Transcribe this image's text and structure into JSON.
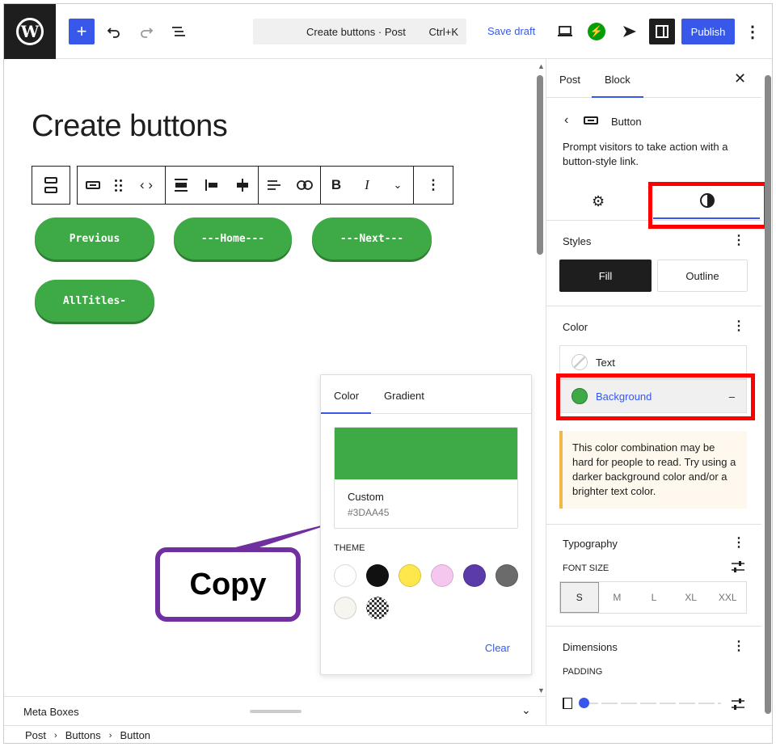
{
  "topbar": {
    "command_title": "Create buttons · Post",
    "command_shortcut": "Ctrl+K",
    "save_draft": "Save draft",
    "publish": "Publish"
  },
  "canvas": {
    "title": "Create buttons",
    "buttons": [
      "Previous",
      "---Home---",
      "---Next---",
      "AllTitles-"
    ]
  },
  "color_popover": {
    "tabs": [
      "Color",
      "Gradient"
    ],
    "swatch_label": "Custom",
    "swatch_hex": "#3DAA45",
    "theme_label": "THEME",
    "theme_colors": [
      "#ffffff",
      "#111111",
      "#fde74c",
      "#f5c7f0",
      "#5b3ba8",
      "#6b6b6b",
      "#f6f5ef",
      "checker"
    ],
    "clear": "Clear"
  },
  "callout": {
    "text": "Copy"
  },
  "metabox": {
    "label": "Meta Boxes"
  },
  "breadcrumb": [
    "Post",
    "Buttons",
    "Button"
  ],
  "sidebar": {
    "tabs": [
      "Post",
      "Block"
    ],
    "block_name": "Button",
    "block_desc": "Prompt visitors to take action with a button-style link.",
    "styles": {
      "heading": "Styles",
      "options": [
        "Fill",
        "Outline"
      ]
    },
    "color": {
      "heading": "Color",
      "text_label": "Text",
      "background_label": "Background",
      "warning": "This color combination may be hard for people to read. Try using a darker background color and/or a brighter text color."
    },
    "typography": {
      "heading": "Typography",
      "font_size_label": "FONT SIZE",
      "sizes": [
        "S",
        "M",
        "L",
        "XL",
        "XXL"
      ],
      "selected": "S"
    },
    "dimensions": {
      "heading": "Dimensions",
      "padding_label": "PADDING"
    }
  },
  "colors": {
    "accent": "#3858e9",
    "button_green": "#3DAA45",
    "highlight_red": "#ff0000",
    "callout_purple": "#7030a0"
  }
}
